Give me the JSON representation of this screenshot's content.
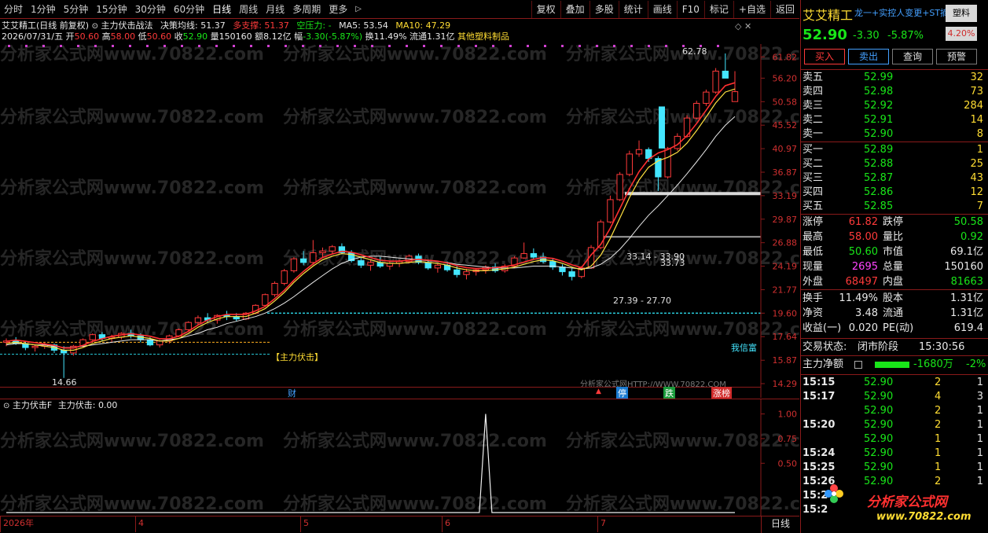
{
  "toolbar": {
    "periods": [
      "分时",
      "1分钟",
      "5分钟",
      "15分钟",
      "30分钟",
      "60分钟",
      "日线",
      "周线",
      "月线",
      "多周期",
      "更多"
    ],
    "active": "日线",
    "tools": [
      "复权",
      "叠加",
      "多股",
      "统计",
      "画线",
      "F10",
      "标记",
      "+自选",
      "返回"
    ]
  },
  "chart_header": {
    "stock": "艾艾精工(日线 前复权)",
    "indicator": "主力伏击战法",
    "decision_label": "决策均线:",
    "decision_value": "51.37",
    "support_label": "多支撑:",
    "support_value": "51.37",
    "pressure_label": "空压力:",
    "pressure_value": "-",
    "ma5_label": "MA5:",
    "ma5_value": "53.54",
    "ma10_label": "MA10:",
    "ma10_value": "47.29"
  },
  "bar_info": {
    "date": "2026/07/31/五",
    "open_label": "开",
    "open": "50.60",
    "high_label": "高",
    "high": "58.00",
    "low_label": "低",
    "low": "50.60",
    "close_label": "收",
    "close": "52.90",
    "vol_label": "量",
    "vol": "150160",
    "amount_label": "额",
    "amount": "8.12亿",
    "change_label": "幅",
    "change": "-3.30(-5.87%)",
    "turnover_label": "换",
    "turnover": "11.49%",
    "float_label": "流通",
    "float": "1.31亿",
    "sector": "其他塑料制品"
  },
  "chart_annotations": {
    "max_price": "62.78",
    "min_price": "14.66",
    "range_upper": "33.14 - 33.90",
    "range_upper_sub": "33.73",
    "range_lower": "27.39 - 27.70",
    "signal_label": "【主力伏击】",
    "right_label": "我信富",
    "marker_cai": "财",
    "marker_ting": "停",
    "marker_die": "跌",
    "marker_zhangting": "涨榜",
    "watermark": "分析家公式网www.70822.com",
    "url_text": "分析家公式网HTTP://WWW.70822.COM"
  },
  "price_axis": [
    "61.82",
    "56.20",
    "50.58",
    "45.52",
    "40.97",
    "36.87",
    "33.19",
    "29.87",
    "26.88",
    "24.19",
    "21.77",
    "19.60",
    "17.64",
    "15.87",
    "14.29"
  ],
  "sub_chart": {
    "title": "主力伏击F",
    "value_label": "主力伏击:",
    "value": "0.00",
    "axis": [
      "1.00",
      "0.75",
      "0.50"
    ]
  },
  "date_axis": [
    "2026年",
    "4",
    "5",
    "6",
    "7"
  ],
  "date_axis_right": "日线",
  "chart_data": {
    "type": "candlestick",
    "price_range": [
      14.29,
      62.78
    ],
    "ohlc": [
      [
        17.2,
        17.5,
        16.9,
        17.3
      ],
      [
        17.3,
        17.6,
        17.0,
        17.1
      ],
      [
        17.1,
        17.3,
        16.6,
        16.8
      ],
      [
        16.8,
        17.0,
        16.5,
        16.9
      ],
      [
        16.9,
        17.2,
        16.7,
        17.0
      ],
      [
        17.0,
        17.1,
        16.4,
        16.6
      ],
      [
        16.6,
        16.9,
        14.66,
        16.4
      ],
      [
        16.4,
        17.0,
        16.2,
        16.9
      ],
      [
        16.9,
        17.5,
        16.8,
        17.4
      ],
      [
        17.4,
        17.9,
        17.2,
        17.8
      ],
      [
        17.8,
        18.0,
        17.3,
        17.5
      ],
      [
        17.5,
        17.8,
        17.2,
        17.6
      ],
      [
        17.6,
        18.0,
        17.4,
        17.9
      ],
      [
        17.9,
        18.2,
        17.5,
        17.7
      ],
      [
        17.7,
        17.9,
        17.2,
        17.4
      ],
      [
        17.4,
        17.6,
        16.9,
        17.0
      ],
      [
        17.0,
        17.4,
        16.8,
        17.3
      ],
      [
        17.3,
        17.8,
        17.1,
        17.7
      ],
      [
        17.7,
        18.3,
        17.6,
        18.2
      ],
      [
        18.2,
        18.9,
        18.0,
        18.8
      ],
      [
        18.8,
        19.4,
        18.6,
        19.2
      ],
      [
        19.2,
        19.6,
        18.8,
        19.0
      ],
      [
        19.0,
        19.5,
        18.7,
        19.4
      ],
      [
        19.4,
        19.8,
        19.0,
        19.3
      ],
      [
        19.3,
        19.6,
        18.9,
        19.1
      ],
      [
        19.1,
        19.7,
        19.0,
        19.6
      ],
      [
        19.6,
        20.4,
        19.5,
        20.3
      ],
      [
        20.3,
        21.4,
        20.2,
        21.3
      ],
      [
        21.3,
        22.6,
        21.1,
        22.4
      ],
      [
        22.4,
        23.9,
        22.2,
        23.7
      ],
      [
        23.7,
        25.2,
        23.5,
        25.0
      ],
      [
        25.0,
        25.9,
        24.3,
        24.6
      ],
      [
        24.6,
        27.2,
        24.4,
        25.7
      ],
      [
        25.7,
        26.3,
        25.1,
        25.9
      ],
      [
        25.9,
        26.6,
        25.6,
        26.4
      ],
      [
        26.4,
        26.8,
        25.5,
        25.7
      ],
      [
        25.7,
        26.0,
        24.6,
        24.8
      ],
      [
        24.8,
        25.3,
        24.0,
        24.3
      ],
      [
        24.3,
        24.9,
        23.7,
        24.6
      ],
      [
        24.6,
        25.2,
        24.0,
        24.2
      ],
      [
        24.2,
        24.8,
        23.8,
        24.5
      ],
      [
        24.5,
        24.9,
        24.1,
        24.7
      ],
      [
        24.7,
        25.5,
        24.5,
        25.3
      ],
      [
        25.3,
        25.6,
        24.4,
        24.6
      ],
      [
        24.6,
        24.9,
        23.8,
        24.0
      ],
      [
        24.0,
        24.5,
        23.5,
        24.3
      ],
      [
        24.3,
        24.7,
        23.6,
        23.8
      ],
      [
        23.8,
        24.2,
        23.0,
        23.3
      ],
      [
        23.3,
        23.9,
        22.8,
        23.6
      ],
      [
        23.6,
        24.0,
        23.2,
        23.8
      ],
      [
        23.8,
        24.3,
        23.4,
        24.1
      ],
      [
        24.1,
        24.5,
        23.5,
        23.7
      ],
      [
        23.7,
        24.4,
        23.5,
        24.2
      ],
      [
        24.2,
        25.3,
        24.0,
        25.1
      ],
      [
        25.1,
        26.9,
        25.0,
        25.6
      ],
      [
        25.6,
        26.2,
        24.9,
        25.2
      ],
      [
        25.2,
        25.7,
        24.5,
        24.7
      ],
      [
        24.7,
        25.0,
        23.8,
        24.1
      ],
      [
        24.1,
        24.4,
        23.2,
        23.6
      ],
      [
        23.6,
        24.0,
        22.7,
        23.1
      ],
      [
        23.1,
        24.2,
        22.9,
        24.0
      ],
      [
        24.0,
        26.6,
        23.9,
        26.3
      ],
      [
        26.3,
        29.8,
        26.1,
        29.5
      ],
      [
        29.5,
        33.2,
        29.3,
        32.6
      ],
      [
        32.6,
        36.9,
        32.4,
        36.5
      ],
      [
        36.5,
        40.6,
        36.2,
        40.0
      ],
      [
        40.0,
        42.5,
        39.5,
        40.8
      ],
      [
        40.8,
        41.2,
        38.6,
        39.2
      ],
      [
        39.2,
        39.6,
        33.9,
        36.1
      ],
      [
        36.1,
        41.3,
        35.8,
        41.0
      ],
      [
        41.0,
        43.9,
        40.6,
        43.3
      ],
      [
        43.3,
        47.6,
        43.0,
        47.0
      ],
      [
        47.0,
        50.8,
        46.7,
        50.2
      ],
      [
        50.2,
        53.4,
        49.6,
        52.8
      ],
      [
        52.8,
        58.8,
        52.4,
        58.0
      ],
      [
        58.0,
        62.78,
        57.0,
        56.2
      ],
      [
        50.6,
        58.0,
        50.6,
        52.9
      ]
    ],
    "ma_white": [
      17.0,
      17.1,
      17.1,
      17.0,
      17.0,
      16.9,
      16.8,
      16.8,
      16.9,
      17.0,
      17.1,
      17.2,
      17.3,
      17.4,
      17.4,
      17.4,
      17.3,
      17.4,
      17.5,
      17.7,
      17.9,
      18.2,
      18.4,
      18.7,
      18.9,
      19.1,
      19.3,
      19.6,
      20.0,
      20.5,
      21.1,
      21.8,
      22.5,
      23.2,
      23.9,
      24.5,
      24.9,
      25.2,
      25.3,
      25.3,
      25.2,
      25.1,
      25.0,
      24.9,
      24.8,
      24.7,
      24.6,
      24.4,
      24.3,
      24.2,
      24.1,
      24.0,
      24.0,
      24.0,
      24.1,
      24.2,
      24.2,
      24.2,
      24.1,
      24.0,
      23.9,
      24.0,
      24.4,
      25.1,
      26.1,
      27.4,
      28.9,
      30.4,
      31.7,
      33.2,
      34.8,
      36.6,
      38.6,
      40.8,
      43.3,
      45.5,
      47.3
    ],
    "ma_yellow": [
      17.1,
      17.2,
      17.1,
      17.0,
      16.9,
      16.8,
      16.6,
      16.6,
      16.8,
      17.1,
      17.3,
      17.5,
      17.6,
      17.7,
      17.6,
      17.5,
      17.3,
      17.3,
      17.5,
      17.9,
      18.4,
      18.8,
      19.1,
      19.3,
      19.3,
      19.3,
      19.6,
      20.0,
      20.7,
      21.5,
      22.5,
      23.4,
      24.2,
      24.9,
      25.3,
      25.6,
      25.5,
      25.2,
      24.9,
      24.6,
      24.5,
      24.5,
      24.6,
      24.7,
      24.6,
      24.5,
      24.3,
      24.0,
      23.8,
      23.7,
      23.7,
      23.8,
      23.9,
      24.1,
      24.4,
      24.7,
      24.9,
      24.8,
      24.5,
      24.1,
      23.8,
      24.2,
      25.4,
      27.4,
      30.0,
      32.9,
      35.6,
      37.7,
      38.8,
      39.4,
      40.3,
      42.0,
      44.4,
      47.2,
      50.3,
      52.8,
      53.54
    ],
    "signal": {
      "index": 50,
      "value": 1.0
    },
    "sub_range": [
      0,
      1.1
    ]
  },
  "right_panel": {
    "name": "艾艾精工",
    "tags": "龙一+实控人变更+ST摘",
    "sector_btn": "塑料",
    "sector_chg": "4.20%",
    "price": "52.90",
    "change": "-3.30",
    "pct": "-5.87%",
    "buttons": [
      "买入",
      "卖出",
      "查询",
      "预警"
    ],
    "asks": [
      {
        "label": "卖五",
        "price": "52.99",
        "vol": "32"
      },
      {
        "label": "卖四",
        "price": "52.98",
        "vol": "73"
      },
      {
        "label": "卖三",
        "price": "52.92",
        "vol": "284"
      },
      {
        "label": "卖二",
        "price": "52.91",
        "vol": "14"
      },
      {
        "label": "卖一",
        "price": "52.90",
        "vol": "8"
      }
    ],
    "bids": [
      {
        "label": "买一",
        "price": "52.89",
        "vol": "1"
      },
      {
        "label": "买二",
        "price": "52.88",
        "vol": "25"
      },
      {
        "label": "买三",
        "price": "52.87",
        "vol": "43"
      },
      {
        "label": "买四",
        "price": "52.86",
        "vol": "12"
      },
      {
        "label": "买五",
        "price": "52.85",
        "vol": "7"
      }
    ],
    "stats": [
      {
        "l1": "涨停",
        "v1": "61.82",
        "l2": "跌停",
        "v2": "50.58",
        "c1": "red",
        "c2": "green"
      },
      {
        "l1": "最高",
        "v1": "58.00",
        "l2": "量比",
        "v2": "0.92",
        "c1": "red",
        "c2": "green"
      },
      {
        "l1": "最低",
        "v1": "50.60",
        "l2": "市值",
        "v2": "69.1亿",
        "c1": "green",
        "c2": "white"
      },
      {
        "l1": "现量",
        "v1": "2695",
        "l2": "总量",
        "v2": "150160",
        "c1": "magenta",
        "c2": "white"
      },
      {
        "l1": "外盘",
        "v1": "68497",
        "l2": "内盘",
        "v2": "81663",
        "c1": "red",
        "c2": "green"
      }
    ],
    "stats2": [
      {
        "l1": "换手",
        "v1": "11.49%",
        "l2": "股本",
        "v2": "1.31亿"
      },
      {
        "l1": "净资",
        "v1": "3.48",
        "l2": "流通",
        "v2": "1.31亿"
      },
      {
        "l1": "收益(一)",
        "v1": "0.020",
        "l2": "PE(动)",
        "v2": "619.4"
      }
    ],
    "trade_status_label": "交易状态:",
    "trade_status": "闭市阶段",
    "trade_time": "15:30:56",
    "net_label": "主力净额",
    "net_value": "-1680万",
    "net_pct": "-2%",
    "ticks": [
      {
        "t": "15:15",
        "p": "52.90",
        "v": "2",
        "n": "1"
      },
      {
        "t": "15:17",
        "p": "52.90",
        "v": "4",
        "n": "3"
      },
      {
        "t": "",
        "p": "52.90",
        "v": "2",
        "n": "1"
      },
      {
        "t": "15:20",
        "p": "52.90",
        "v": "2",
        "n": "1"
      },
      {
        "t": "",
        "p": "52.90",
        "v": "1",
        "n": "1"
      },
      {
        "t": "15:24",
        "p": "52.90",
        "v": "1",
        "n": "1"
      },
      {
        "t": "15:25",
        "p": "52.90",
        "v": "1",
        "n": "1"
      },
      {
        "t": "15:26",
        "p": "52.90",
        "v": "2",
        "n": "1"
      },
      {
        "t": "15:2",
        "p": "",
        "v": "",
        "n": ""
      },
      {
        "t": "15:2",
        "p": "",
        "v": "",
        "n": ""
      }
    ],
    "logo_text": "分析家公式网",
    "logo_url": "www.70822.com"
  }
}
